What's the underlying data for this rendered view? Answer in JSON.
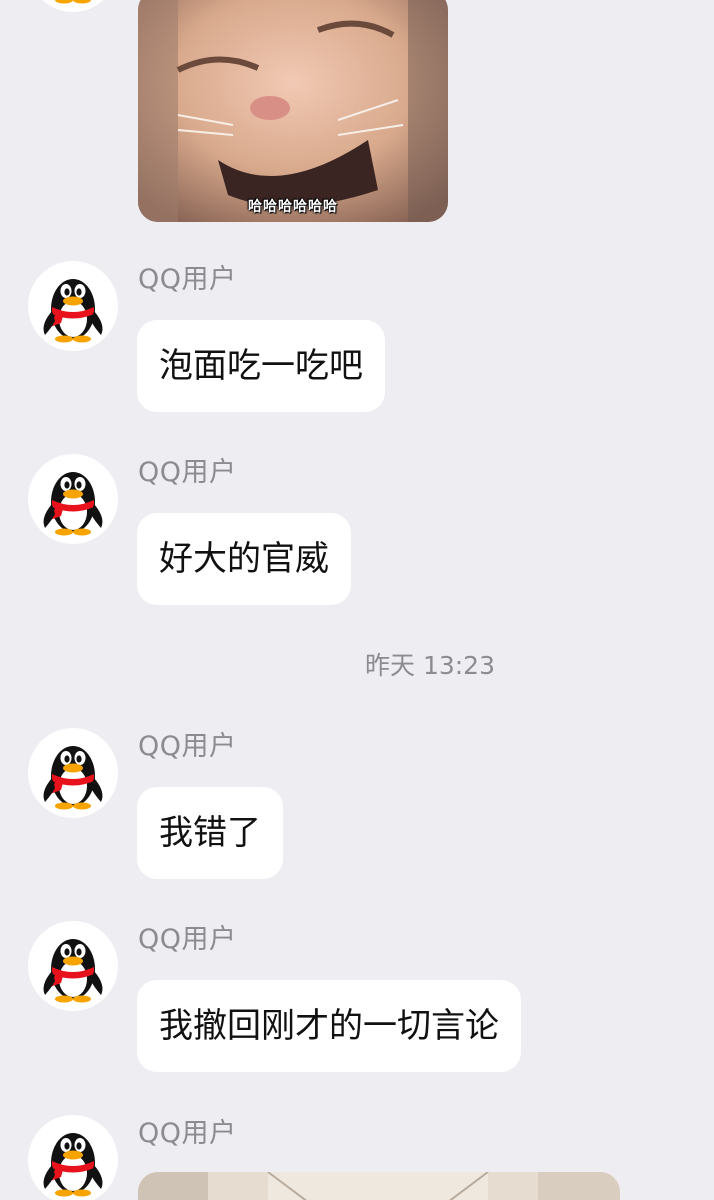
{
  "chat": {
    "sticker": {
      "caption": "哈哈哈哈哈哈",
      "icon": "laughing-cat-sticker"
    },
    "messages": [
      {
        "sender": "QQ用户",
        "text": "泡面吃一吃吧"
      },
      {
        "sender": "QQ用户",
        "text": "好大的官威"
      },
      {
        "sender": "QQ用户",
        "text": "我错了"
      },
      {
        "sender": "QQ用户",
        "text": "我撤回刚才的一切言论"
      },
      {
        "sender": "QQ用户",
        "image": "room-photo"
      }
    ],
    "timestamp": "昨天 13:23",
    "avatar_icon": "qq-penguin-avatar-icon"
  },
  "colors": {
    "background": "#eeeef2",
    "bubble": "#ffffff",
    "meta_text": "#8c8c90",
    "penguin_scarf": "#e8121c",
    "penguin_beak": "#f7a400"
  }
}
